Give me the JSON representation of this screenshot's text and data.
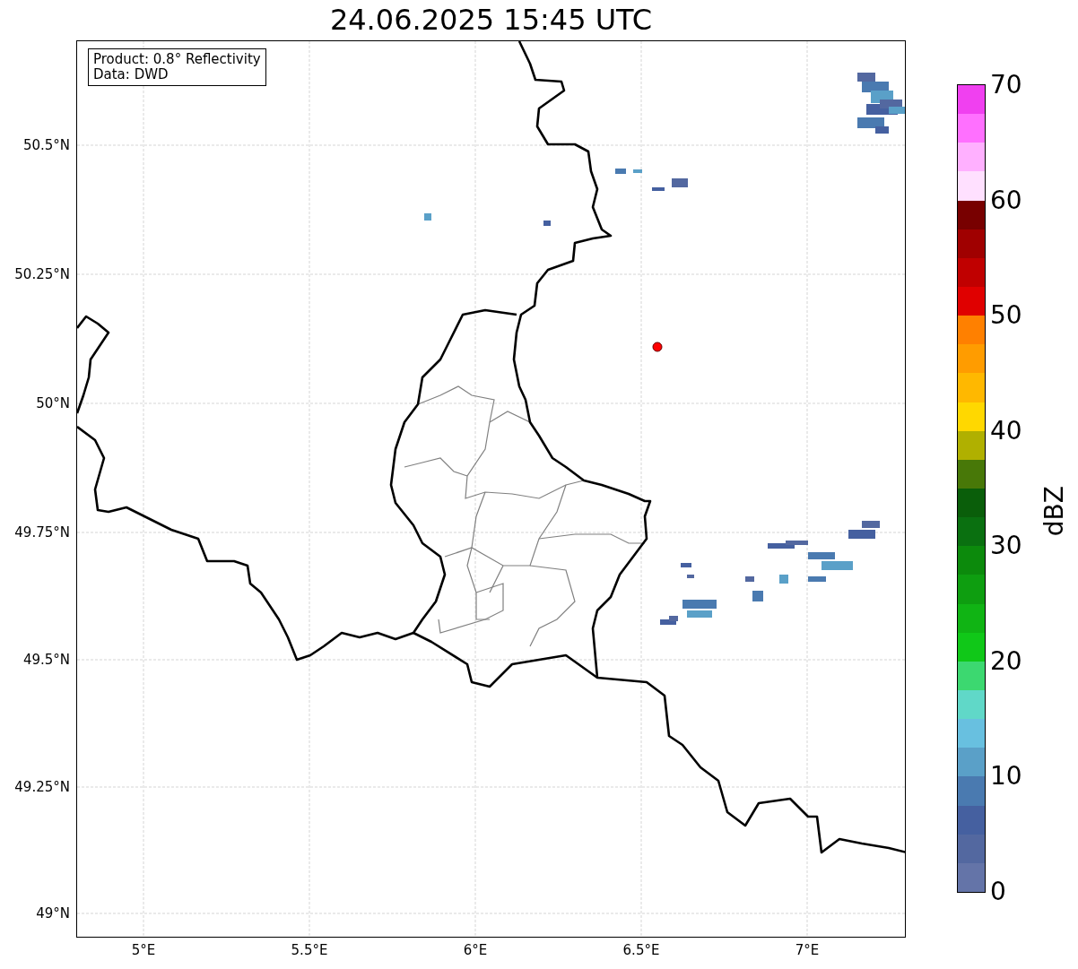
{
  "title": "24.06.2025 15:45 UTC",
  "info_box": [
    "Product: 0.8° Reflectivity",
    "Data: DWD"
  ],
  "map": {
    "x_ticks": [
      "5°E",
      "5.5°E",
      "6°E",
      "6.5°E",
      "7°E"
    ],
    "y_ticks": [
      "50.5°N",
      "50.25°N",
      "50°N",
      "49.75°N",
      "49.5°N",
      "49.25°N",
      "49°N"
    ]
  },
  "colorbar": {
    "label": "dBZ",
    "ticks": [
      "70",
      "60",
      "50",
      "40",
      "30",
      "20",
      "10",
      "0"
    ],
    "segments": [
      {
        "color": "#f040f0"
      },
      {
        "color": "#ff70ff"
      },
      {
        "color": "#ffb0ff"
      },
      {
        "color": "#ffe0ff"
      },
      {
        "color": "#780000"
      },
      {
        "color": "#a00000"
      },
      {
        "color": "#c00000"
      },
      {
        "color": "#e00000"
      },
      {
        "color": "#ff8000"
      },
      {
        "color": "#ff9c00"
      },
      {
        "color": "#ffb800"
      },
      {
        "color": "#ffd800"
      },
      {
        "color": "#b0b000"
      },
      {
        "color": "#487808"
      },
      {
        "color": "#0a5e0a"
      },
      {
        "color": "#0a7010"
      },
      {
        "color": "#0c8a0c"
      },
      {
        "color": "#0e9e10"
      },
      {
        "color": "#10b414"
      },
      {
        "color": "#10c818"
      },
      {
        "color": "#3cd870"
      },
      {
        "color": "#60d8c8"
      },
      {
        "color": "#68c0e0"
      },
      {
        "color": "#5aa0c8"
      },
      {
        "color": "#4a7ab0"
      },
      {
        "color": "#4560a0"
      },
      {
        "color": "#5368a0"
      },
      {
        "color": "#6474a8"
      }
    ]
  }
}
